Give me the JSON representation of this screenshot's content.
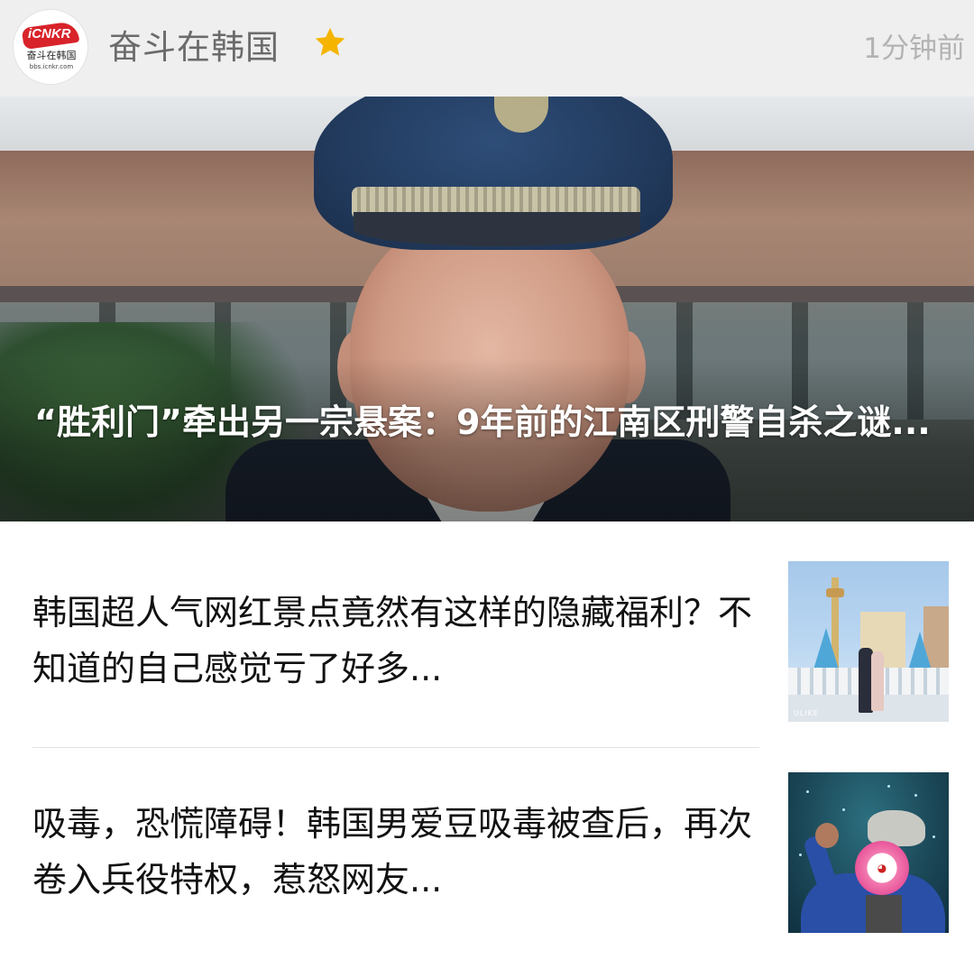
{
  "header": {
    "account_name": "奋斗在韩国",
    "time": "1分钟前",
    "avatar": {
      "brand": "iCNKR",
      "brand_cn": "奋斗在韩国",
      "brand_url": "bbs.icnkr.com"
    },
    "star_icon": "star-icon",
    "star_color": "#f5b400"
  },
  "hero": {
    "title": "“胜利门”牵出另一宗悬案：9年前的江南区刑警自杀之谜..."
  },
  "articles": [
    {
      "title": "韩国超人气网红景点竟然有这样的隐藏福利？不知道的自己感觉亏了好多...",
      "thumb_watermark": "ULIKE"
    },
    {
      "title": "吸毒，恐慌障碍！韩国男爱豆吸毒被查后，再次卷入兵役特权，惹怒网友..."
    }
  ]
}
